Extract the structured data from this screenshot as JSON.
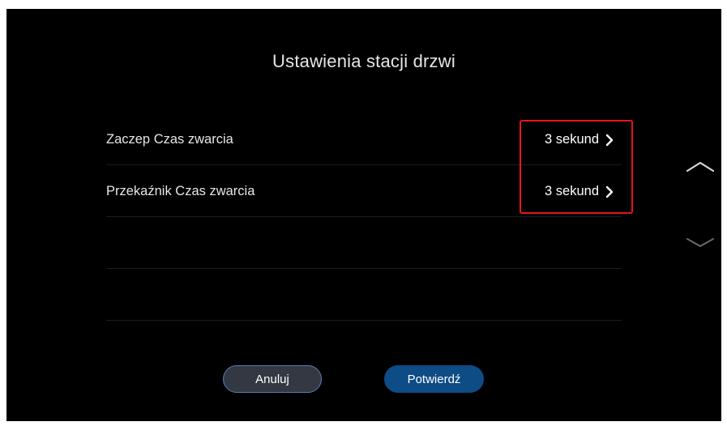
{
  "header": {
    "title": "Ustawienia stacji drzwi"
  },
  "settings": {
    "items": [
      {
        "label": "Zaczep Czas zwarcia",
        "value": "3 sekund"
      },
      {
        "label": "Przekaźnik Czas zwarcia",
        "value": "3 sekund"
      },
      {
        "label": "",
        "value": ""
      },
      {
        "label": "",
        "value": ""
      }
    ]
  },
  "scroll": {
    "up_icon": "chevron-up-icon",
    "down_icon": "chevron-down-icon"
  },
  "footer": {
    "cancel_label": "Anuluj",
    "confirm_label": "Potwierdź"
  },
  "colors": {
    "background": "#000000",
    "text": "#e6e6e6",
    "highlight": "#e8131b",
    "confirm_button": "#0e4c86",
    "cancel_button": "#333842"
  }
}
